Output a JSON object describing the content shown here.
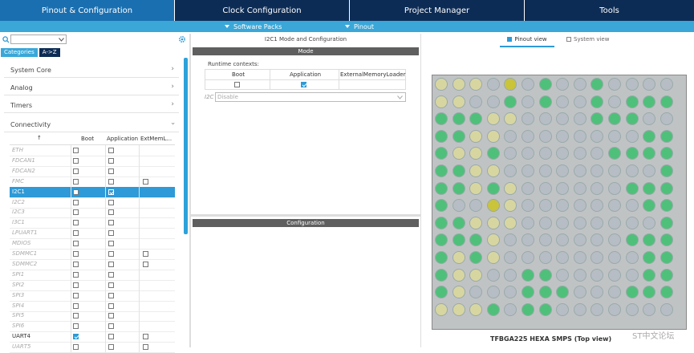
{
  "tabs": [
    {
      "label": "Pinout & Configuration",
      "active": true
    },
    {
      "label": "Clock Configuration"
    },
    {
      "label": "Project Manager"
    },
    {
      "label": "Tools"
    }
  ],
  "subtabs": [
    {
      "label": "Software Packs"
    },
    {
      "label": "Pinout"
    }
  ],
  "left": {
    "categories_tab": "Categories",
    "az_tab": "A->Z",
    "sections": [
      "System Core",
      "Analog",
      "Timers",
      "Connectivity"
    ],
    "columns": [
      "Boot",
      "Application",
      "ExtMemL..."
    ],
    "rows": [
      {
        "name": "ETH",
        "boot": false,
        "app": false,
        "ext": null
      },
      {
        "name": "FDCAN1",
        "boot": false,
        "app": false,
        "ext": null
      },
      {
        "name": "FDCAN2",
        "boot": false,
        "app": false,
        "ext": null
      },
      {
        "name": "FMC",
        "boot": false,
        "app": false,
        "ext": false
      },
      {
        "name": "I2C1",
        "boot": false,
        "app": true,
        "ext": null,
        "selected": true
      },
      {
        "name": "I2C2",
        "boot": false,
        "app": false,
        "ext": null
      },
      {
        "name": "I2C3",
        "boot": false,
        "app": false,
        "ext": null
      },
      {
        "name": "I3C1",
        "boot": false,
        "app": false,
        "ext": null
      },
      {
        "name": "LPUART1",
        "boot": false,
        "app": false,
        "ext": null
      },
      {
        "name": "MDIOS",
        "boot": false,
        "app": false,
        "ext": null
      },
      {
        "name": "SDMMC1",
        "boot": false,
        "app": false,
        "ext": false
      },
      {
        "name": "SDMMC2",
        "boot": false,
        "app": false,
        "ext": false
      },
      {
        "name": "SPI1",
        "boot": false,
        "app": false,
        "ext": null
      },
      {
        "name": "SPI2",
        "boot": false,
        "app": false,
        "ext": null
      },
      {
        "name": "SPI3",
        "boot": false,
        "app": false,
        "ext": null
      },
      {
        "name": "SPI4",
        "boot": false,
        "app": false,
        "ext": null
      },
      {
        "name": "SPI5",
        "boot": false,
        "app": false,
        "ext": null
      },
      {
        "name": "SPI6",
        "boot": false,
        "app": false,
        "ext": null
      },
      {
        "name": "UART4",
        "boot": true,
        "app": false,
        "ext": false,
        "enabled": true
      },
      {
        "name": "UART5",
        "boot": false,
        "app": false,
        "ext": false
      }
    ]
  },
  "mid": {
    "title": "I2C1 Mode and Configuration",
    "mode_header": "Mode",
    "runtime_label": "Runtime contexts:",
    "runtime_cols": [
      "Boot",
      "Application",
      "ExternalMemoryLoader"
    ],
    "i2c_label": "I2C",
    "i2c_value": "Disable",
    "config_header": "Configuration"
  },
  "right": {
    "pinout_view": "Pinout view",
    "system_view": "System view",
    "package_label": "TFBGA225 HEXA SMPS (Top view)",
    "watermark": "ST中文论坛",
    "pin_colors": {
      "gray": "#b7bdc4",
      "green": "#4fc07a",
      "beige": "#d8d6a0",
      "yellow": "#c9c43a"
    }
  },
  "colors": {
    "tab_active": "#0c3a68",
    "tab": "#0b2f57",
    "accent": "#3aa7d8",
    "header": "#666666"
  }
}
